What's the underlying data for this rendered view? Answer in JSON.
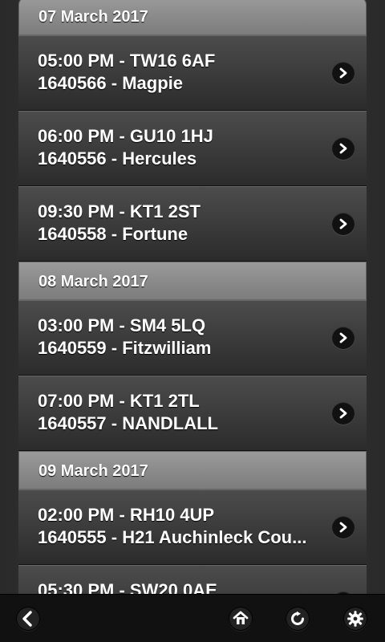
{
  "sections": [
    {
      "date": "07 March 2017",
      "items": [
        {
          "line1": "05:00 PM - TW16 6AF",
          "line2": "1640566 - Magpie"
        },
        {
          "line1": "06:00 PM - GU10 1HJ",
          "line2": "1640556 - Hercules"
        },
        {
          "line1": "09:30 PM - KT1 2ST",
          "line2": "1640558 - Fortune"
        }
      ]
    },
    {
      "date": "08 March 2017",
      "items": [
        {
          "line1": "03:00 PM - SM4 5LQ",
          "line2": "1640559 - Fitzwilliam"
        },
        {
          "line1": "07:00 PM - KT1 2TL",
          "line2": "1640557 - NANDLALL"
        }
      ]
    },
    {
      "date": "09 March 2017",
      "items": [
        {
          "line1": "02:00 PM - RH10 4UP",
          "line2": "1640555 - H21 Auchinleck Cou..."
        },
        {
          "line1": "05:30 PM - SW20 0AE",
          "line2": ""
        }
      ]
    }
  ],
  "toolbar": {
    "icons": [
      "back-icon",
      "home-icon",
      "refresh-icon",
      "settings-icon"
    ]
  }
}
